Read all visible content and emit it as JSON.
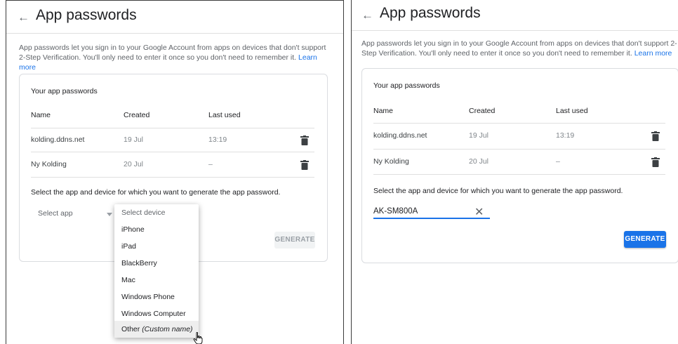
{
  "left": {
    "back_icon": "←",
    "title": "App passwords",
    "description": "App passwords let you sign in to your Google Account from apps on devices that don't support 2-Step Verification. You'll only need to enter it once so you don't need to remember it.",
    "learn_more": "Learn more",
    "card_title": "Your app passwords",
    "columns": {
      "name": "Name",
      "created": "Created",
      "last_used": "Last used"
    },
    "rows": [
      {
        "name": "kolding.ddns.net",
        "created": "19 Jul",
        "last_used": "13:19"
      },
      {
        "name": "Ny Kolding",
        "created": "20 Jul",
        "last_used": "–"
      }
    ],
    "select_prompt": "Select the app and device for which you want to generate the app password.",
    "select_app_placeholder": "Select app",
    "generate_label": "GENERATE",
    "dropdown": {
      "placeholder": "Select device",
      "items": [
        "iPhone",
        "iPad",
        "BlackBerry",
        "Mac",
        "Windows Phone",
        "Windows Computer"
      ],
      "other_label": "Other",
      "other_hint": "(Custom name)"
    }
  },
  "right": {
    "back_icon": "←",
    "title": "App passwords",
    "description": "App passwords let you sign in to your Google Account from apps on devices that don't support 2-Step Verification. You'll only need to enter it once so you don't need to remember it.",
    "learn_more": "Learn more",
    "card_title": "Your app passwords",
    "columns": {
      "name": "Name",
      "created": "Created",
      "last_used": "Last used"
    },
    "rows": [
      {
        "name": "kolding.ddns.net",
        "created": "19 Jul",
        "last_used": "13:19"
      },
      {
        "name": "Ny Kolding",
        "created": "20 Jul",
        "last_used": "–"
      }
    ],
    "select_prompt": "Select the app and device for which you want to generate the app password.",
    "device_input_value": "AK-SM800A",
    "clear_icon": "✕",
    "generate_label": "GENERATE"
  },
  "colors": {
    "accent": "#1a73e8",
    "border": "#dadce0",
    "muted": "#5f6368"
  },
  "icons": {
    "delete": "trash-icon",
    "back": "arrow-left-icon",
    "clear": "close-icon",
    "dropdown": "caret-down-icon",
    "pointer": "hand-cursor-icon"
  }
}
